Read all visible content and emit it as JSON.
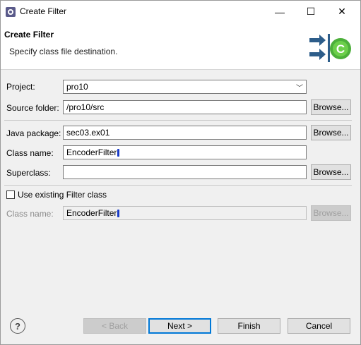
{
  "window": {
    "title": "Create Filter",
    "minimize_glyph": "—",
    "maximize_glyph": "☐",
    "close_glyph": "✕"
  },
  "banner": {
    "title": "Create Filter",
    "description": "Specify class file destination."
  },
  "form": {
    "project_label": "Project:",
    "project_value": "pro10",
    "source_folder_label": "Source folder:",
    "source_folder_value": "/pro10/src",
    "java_package_label": "Java package:",
    "java_package_value": "sec03.ex01",
    "class_name_label": "Class name:",
    "class_name_value": "EncoderFilter",
    "superclass_label": "Superclass:",
    "superclass_value": "",
    "use_existing_label": "Use existing Filter class",
    "use_existing_checked": false,
    "existing_class_label": "Class name:",
    "existing_class_value": "EncoderFilter",
    "browse_label": "Browse..."
  },
  "footer": {
    "help_glyph": "?",
    "back_label": "< Back",
    "next_label": "Next >",
    "finish_label": "Finish",
    "cancel_label": "Cancel"
  },
  "colors": {
    "accent": "#0078d7",
    "cursor": "#1a3cc8"
  }
}
